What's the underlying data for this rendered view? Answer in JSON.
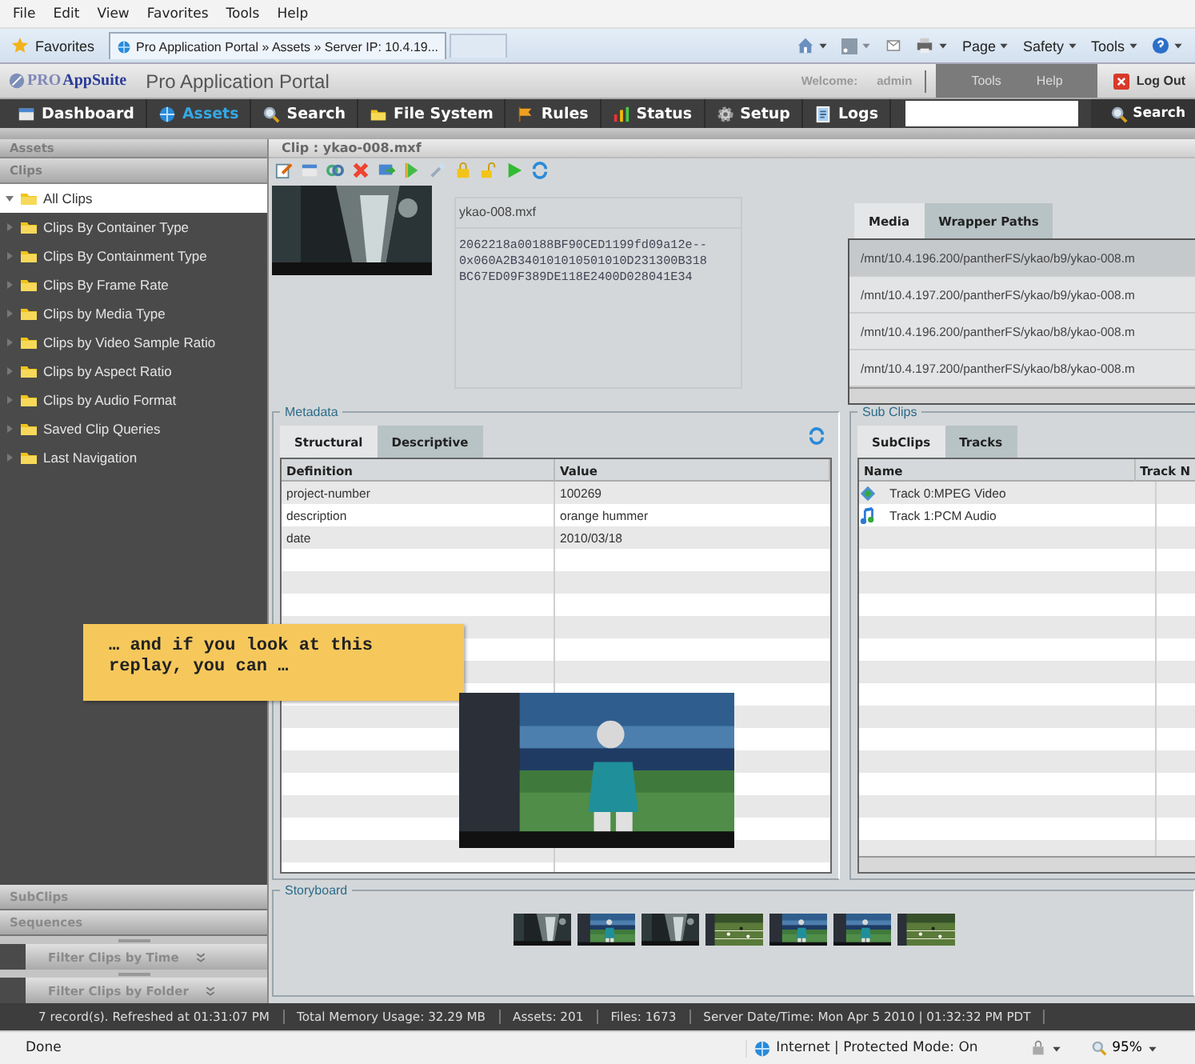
{
  "browser": {
    "menu": [
      "File",
      "Edit",
      "View",
      "Favorites",
      "Tools",
      "Help"
    ],
    "favorites": "Favorites",
    "tab_title": "Pro Application Portal » Assets » Server IP: 10.4.19...",
    "commands": [
      "Page",
      "Safety",
      "Tools"
    ]
  },
  "app": {
    "logo_prefix": "PRO",
    "logo": "AppSuite",
    "title": "Pro Application Portal",
    "welcome": "Welcome:",
    "user": "admin",
    "links": [
      "Tools",
      "Help"
    ],
    "logout": "Log Out"
  },
  "nav": {
    "items": [
      {
        "label": "Dashboard",
        "selected": false
      },
      {
        "label": "Assets",
        "selected": true
      },
      {
        "label": "Search",
        "selected": false
      },
      {
        "label": "File System",
        "selected": false
      },
      {
        "label": "Rules",
        "selected": false
      },
      {
        "label": "Status",
        "selected": false
      },
      {
        "label": "Setup",
        "selected": false
      },
      {
        "label": "Logs",
        "selected": false
      }
    ],
    "search_button": "Search"
  },
  "sidebar": {
    "sections": [
      "Assets",
      "Clips"
    ],
    "tree": [
      {
        "label": "All Clips",
        "expanded": true,
        "selected": true
      },
      {
        "label": "Clips By Container Type",
        "expanded": false,
        "selected": false
      },
      {
        "label": "Clips By Containment Type",
        "expanded": false,
        "selected": false
      },
      {
        "label": "Clips By Frame Rate",
        "expanded": false,
        "selected": false
      },
      {
        "label": "Clips by Media Type",
        "expanded": false,
        "selected": false
      },
      {
        "label": "Clips by Video Sample Ratio",
        "expanded": false,
        "selected": false
      },
      {
        "label": "Clips by Aspect Ratio",
        "expanded": false,
        "selected": false
      },
      {
        "label": "Clips by Audio Format",
        "expanded": false,
        "selected": false
      },
      {
        "label": "Saved Clip Queries",
        "expanded": false,
        "selected": false
      },
      {
        "label": "Last Navigation",
        "expanded": false,
        "selected": false
      }
    ],
    "bottom_sections": [
      "SubClips",
      "Sequences"
    ],
    "filters": [
      "Filter Clips by Time",
      "Filter Clips by Folder"
    ]
  },
  "clip": {
    "header": "Clip : ykao-008.mxf",
    "name": "ykao-008.mxf",
    "hash_lines": [
      "2062218a00188BF90CED1199fd09a12e--",
      "0x060A2B340101010501010D231300B318",
      "BC67ED09F389DE118E2400D028041E34"
    ]
  },
  "media": {
    "tabs": [
      {
        "label": "Media",
        "selected": false
      },
      {
        "label": "Wrapper Paths",
        "selected": true
      }
    ],
    "paths": [
      {
        "text": "/mnt/10.4.196.200/pantherFS/ykao/b9/ykao-008.m",
        "selected": true
      },
      {
        "text": "/mnt/10.4.197.200/pantherFS/ykao/b9/ykao-008.m",
        "selected": false
      },
      {
        "text": "/mnt/10.4.196.200/pantherFS/ykao/b8/ykao-008.m",
        "selected": false
      },
      {
        "text": "/mnt/10.4.197.200/pantherFS/ykao/b8/ykao-008.m",
        "selected": false
      }
    ]
  },
  "metadata": {
    "title": "Metadata",
    "tabs": [
      {
        "label": "Structural",
        "selected": false
      },
      {
        "label": "Descriptive",
        "selected": true
      }
    ],
    "columns": [
      "Definition",
      "Value"
    ],
    "rows": [
      [
        "project-number",
        "100269"
      ],
      [
        "description",
        "orange hummer"
      ],
      [
        "date",
        "2010/03/18"
      ]
    ]
  },
  "subclips": {
    "title": "Sub Clips",
    "tabs": [
      {
        "label": "SubClips",
        "selected": false
      },
      {
        "label": "Tracks",
        "selected": true
      }
    ],
    "columns": [
      "Name",
      "Track N"
    ],
    "tracks": [
      {
        "name": "Track 0:MPEG Video",
        "kind": "video"
      },
      {
        "name": "Track 1:PCM Audio",
        "kind": "audio"
      }
    ]
  },
  "callout": {
    "text": "… and if you look at this replay, you can …"
  },
  "storyboard": {
    "title": "Storyboard"
  },
  "status_bar": [
    "7 record(s). Refreshed at 01:31:07 PM",
    "Total Memory Usage: 32.29 MB",
    "Assets: 201",
    "Files: 1673",
    "Server Date/Time: Mon Apr 5 2010 | 01:32:32 PM  PDT"
  ],
  "browser_status": {
    "text": "Done",
    "zone": "Internet | Protected Mode: On",
    "zoom": "95%"
  }
}
